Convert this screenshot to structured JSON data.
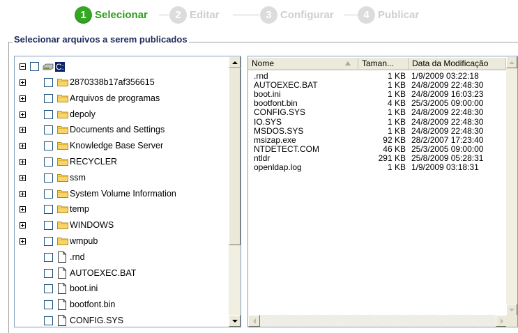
{
  "wizard": {
    "steps": [
      {
        "num": "1",
        "label": "Selecionar",
        "active": true
      },
      {
        "num": "2",
        "label": "Editar",
        "active": false
      },
      {
        "num": "3",
        "label": "Configurar",
        "active": false
      },
      {
        "num": "4",
        "label": "Publicar",
        "active": false
      }
    ]
  },
  "group": {
    "legend": "Selecionar arquivos a serem publicados"
  },
  "tree": {
    "drive_label": "C:",
    "items": [
      {
        "label": "2870338b17af356615",
        "type": "folder"
      },
      {
        "label": "Arquivos de programas",
        "type": "folder"
      },
      {
        "label": "depoly",
        "type": "folder"
      },
      {
        "label": "Documents and Settings",
        "type": "folder"
      },
      {
        "label": "Knowledge Base Server",
        "type": "folder"
      },
      {
        "label": "RECYCLER",
        "type": "folder"
      },
      {
        "label": "ssm",
        "type": "folder"
      },
      {
        "label": "System Volume Information",
        "type": "folder"
      },
      {
        "label": "temp",
        "type": "folder"
      },
      {
        "label": "WINDOWS",
        "type": "folder"
      },
      {
        "label": "wmpub",
        "type": "folder"
      },
      {
        "label": ".rnd",
        "type": "file"
      },
      {
        "label": "AUTOEXEC.BAT",
        "type": "file"
      },
      {
        "label": "boot.ini",
        "type": "file"
      },
      {
        "label": "bootfont.bin",
        "type": "file"
      },
      {
        "label": "CONFIG.SYS",
        "type": "file"
      }
    ]
  },
  "list": {
    "columns": {
      "name": "Nome",
      "size": "Taman...",
      "date": "Data da Modificação"
    },
    "rows": [
      {
        "name": ".rnd",
        "size": "1 KB",
        "date": "1/9/2009 03:22:18"
      },
      {
        "name": "AUTOEXEC.BAT",
        "size": "1 KB",
        "date": "24/8/2009 22:48:30"
      },
      {
        "name": "boot.ini",
        "size": "1 KB",
        "date": "24/8/2009 16:03:23"
      },
      {
        "name": "bootfont.bin",
        "size": "4 KB",
        "date": "25/3/2005 09:00:00"
      },
      {
        "name": "CONFIG.SYS",
        "size": "1 KB",
        "date": "24/8/2009 22:48:30"
      },
      {
        "name": "IO.SYS",
        "size": "1 KB",
        "date": "24/8/2009 22:48:30"
      },
      {
        "name": "MSDOS.SYS",
        "size": "1 KB",
        "date": "24/8/2009 22:48:30"
      },
      {
        "name": "msizap.exe",
        "size": "92 KB",
        "date": "28/2/2007 17:23:40"
      },
      {
        "name": "NTDETECT.COM",
        "size": "46 KB",
        "date": "25/3/2005 09:00:00"
      },
      {
        "name": "ntldr",
        "size": "291 KB",
        "date": "25/8/2009 05:28:31"
      },
      {
        "name": "openldap.log",
        "size": "1 KB",
        "date": "1/9/2009 03:18:31"
      }
    ]
  }
}
